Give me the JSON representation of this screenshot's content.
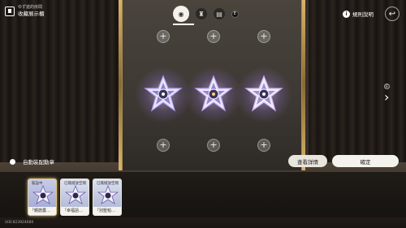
{
  "header": {
    "subtitle": "ゆず遊的房間",
    "title": "收藏展示櫃"
  },
  "tabs": [
    {
      "name": "badge",
      "glyph": "◉"
    },
    {
      "name": "figure",
      "glyph": "♜"
    },
    {
      "name": "card",
      "glyph": "▤"
    }
  ],
  "tab_hint_key": "E",
  "rules_label": "規則說明",
  "edge_hint_key": "E",
  "auto_equip_label": "自動裝配勳章",
  "buttons": {
    "details": "查看詳情",
    "confirm": "確定"
  },
  "tray_cards": [
    {
      "tag": "裝設中",
      "name": "「鋼筋薑…",
      "selected": true
    },
    {
      "tag": "已無擺放空間",
      "name": "「幸福語…",
      "selected": false
    },
    {
      "tag": "已無擺放空間",
      "name": "「別墅帕…",
      "selected": false
    }
  ],
  "uid": "UID:823924680",
  "colors": {
    "accent_gold": "#d9b36a",
    "badge_glow": "#c8b4ff"
  }
}
